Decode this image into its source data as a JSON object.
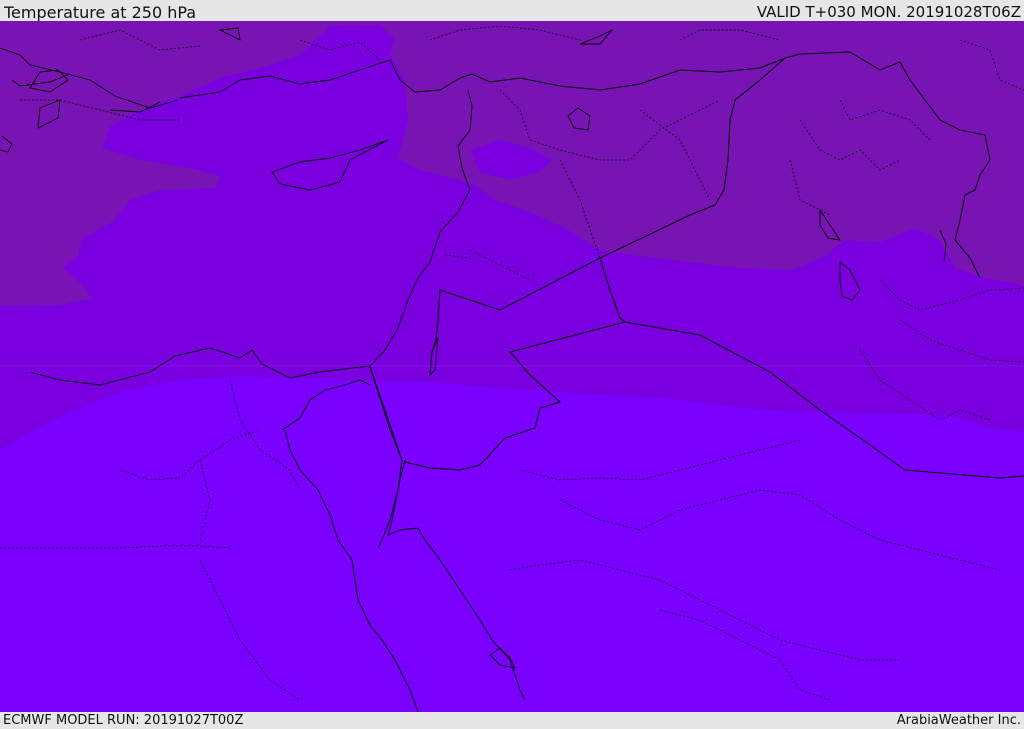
{
  "header": {
    "title": "Temperature at 250 hPa",
    "valid_time": "VALID T+030 MON. 20191028T06Z"
  },
  "footer": {
    "model_run": "ECMWF MODEL RUN: 20191027T00Z",
    "credit": "ArabiaWeather Inc."
  },
  "map": {
    "field": "temperature_250hPa",
    "bands": [
      {
        "name": "coldest",
        "color": "#7914b4"
      },
      {
        "name": "middle",
        "color": "#7a00e0"
      },
      {
        "name": "warmest",
        "color": "#7a00ff"
      }
    ]
  }
}
